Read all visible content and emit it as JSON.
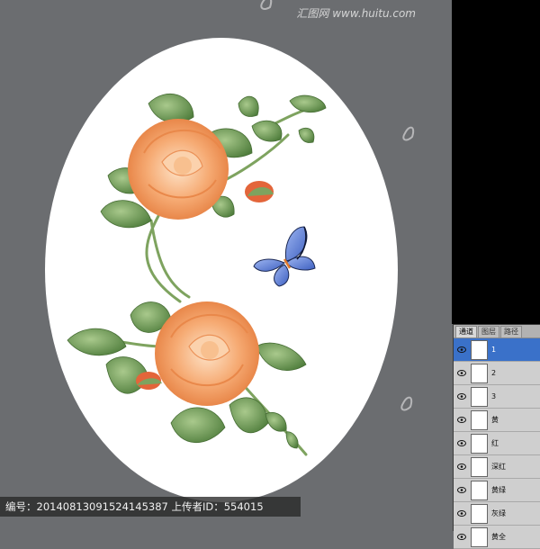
{
  "watermark": {
    "site_text": "汇图网 www.huitu.com"
  },
  "caption": {
    "text": "编号：20140813091524145387 上传者ID：554015"
  },
  "channels_panel": {
    "tabs": [
      {
        "label": "通道",
        "active": true
      },
      {
        "label": "图层",
        "active": false
      },
      {
        "label": "路径",
        "active": false
      }
    ],
    "rows": [
      {
        "label": "1",
        "selected": true
      },
      {
        "label": "2",
        "selected": false
      },
      {
        "label": "3",
        "selected": false
      },
      {
        "label": "黄",
        "selected": false
      },
      {
        "label": "红",
        "selected": false
      },
      {
        "label": "深红",
        "selected": false
      },
      {
        "label": "黄绿",
        "selected": false
      },
      {
        "label": "灰绿",
        "selected": false
      },
      {
        "label": "黄全",
        "selected": false
      }
    ]
  },
  "colors": {
    "canvas_bg": "#6b6d70",
    "selection_blue": "#3a71c9",
    "rose_orange": "#f3a36a",
    "leaf_green": "#6f9a55",
    "butterfly_blue": "#5a7fd6"
  },
  "icons": [
    "eye-icon",
    "butterfly",
    "rose",
    "watermark-logo-icon"
  ]
}
